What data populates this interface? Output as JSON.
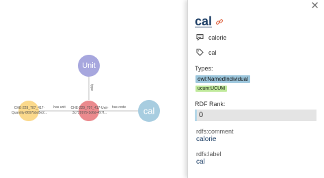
{
  "graph": {
    "nodes": {
      "unit": {
        "label": "Unit"
      },
      "quantity": {
        "label_lines": [
          "CHE-229_707_417-",
          "Quantity-8697bbd5e2..."
        ]
      },
      "unit_instance": {
        "label_lines": [
          "CHE-229_707_417-Unit-",
          "3c729979-3d6d-497f..."
        ]
      },
      "cal": {
        "label": "cal"
      }
    },
    "edges": {
      "type": "type",
      "has_unit": "has unit",
      "has_code": "has code"
    },
    "colors": {
      "unit": "#a7a7de",
      "quantity": "#fbd98c",
      "unit_instance": "#eb8a8e",
      "cal": "#a8cde0"
    }
  },
  "panel": {
    "close_icon": "close-icon",
    "title": "cal",
    "title_icon": "link-icon",
    "comment": "calorie",
    "label": "cal",
    "types_label": "Types:",
    "types": [
      {
        "text": "owl:NamedIndividual",
        "color": "#9cc6dc"
      },
      {
        "text": "ucum:UCUM",
        "color": "#bfe99a"
      }
    ],
    "rank_label": "RDF Rank:",
    "rank_value": "0",
    "properties": [
      {
        "key": "rdfs:comment",
        "value": "calorie"
      },
      {
        "key": "rdfs:label",
        "value": "cal"
      }
    ]
  }
}
